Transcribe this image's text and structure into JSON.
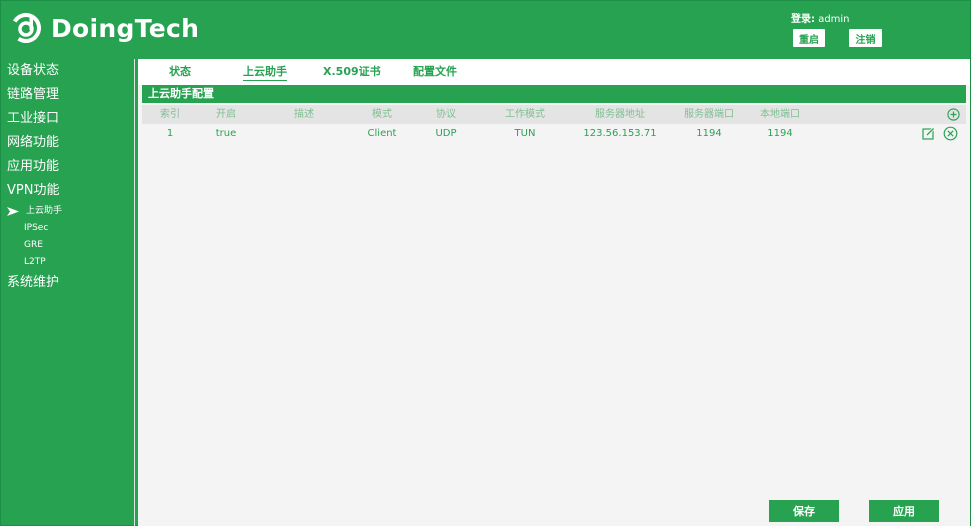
{
  "brand": {
    "name": "DoingTech"
  },
  "header": {
    "login_label": "登录:",
    "login_user": "admin",
    "restart_label": "重启",
    "logout_label": "注销"
  },
  "sidebar": {
    "items": [
      {
        "label": "设备状态"
      },
      {
        "label": "链路管理"
      },
      {
        "label": "工业接口"
      },
      {
        "label": "网络功能"
      },
      {
        "label": "应用功能"
      },
      {
        "label": "VPN功能"
      }
    ],
    "vpn_sub": [
      {
        "label": "上云助手",
        "active": true
      },
      {
        "label": "IPSec"
      },
      {
        "label": "GRE"
      },
      {
        "label": "L2TP"
      }
    ],
    "last_item": {
      "label": "系统维护"
    }
  },
  "tabs": [
    {
      "label": "状态"
    },
    {
      "label": "上云助手",
      "active": true
    },
    {
      "label": "X.509证书"
    },
    {
      "label": "配置文件"
    }
  ],
  "section": {
    "title": "上云助手配置"
  },
  "table": {
    "headers": [
      "索引",
      "开启",
      "描述",
      "模式",
      "协议",
      "工作模式",
      "服务器地址",
      "服务器端口",
      "本地端口"
    ],
    "rows": [
      [
        "1",
        "true",
        "",
        "Client",
        "UDP",
        "TUN",
        "123.56.153.71",
        "1194",
        "1194"
      ]
    ]
  },
  "actions": {
    "save_label": "保存",
    "apply_label": "应用"
  },
  "colors": {
    "brand_green": "#27a251",
    "panel_bg": "#f4f4f4"
  },
  "icons": {
    "logo": "doingtech-logo-icon",
    "add": "add-circle-icon",
    "edit": "edit-icon",
    "delete": "delete-circle-icon",
    "active_arrow": "arrow-right-icon"
  }
}
